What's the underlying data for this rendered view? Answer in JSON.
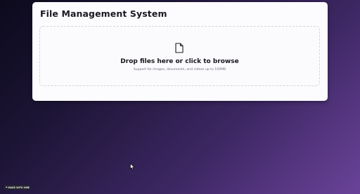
{
  "app": {
    "title": "File Management System"
  },
  "upload": {
    "prompt": "Drop files here or click to browse",
    "hint": "Support for images, documents, and videos up to 100MB",
    "icon": "file-icon"
  },
  "badge": {
    "label": "MADE WITH VIBE",
    "icon": "heart-icon"
  },
  "colors": {
    "card_background": "#fcfcfe",
    "dropzone_border": "#d3d5dc",
    "background_dark": "#0c0a1c",
    "background_purple": "#6a4399"
  }
}
